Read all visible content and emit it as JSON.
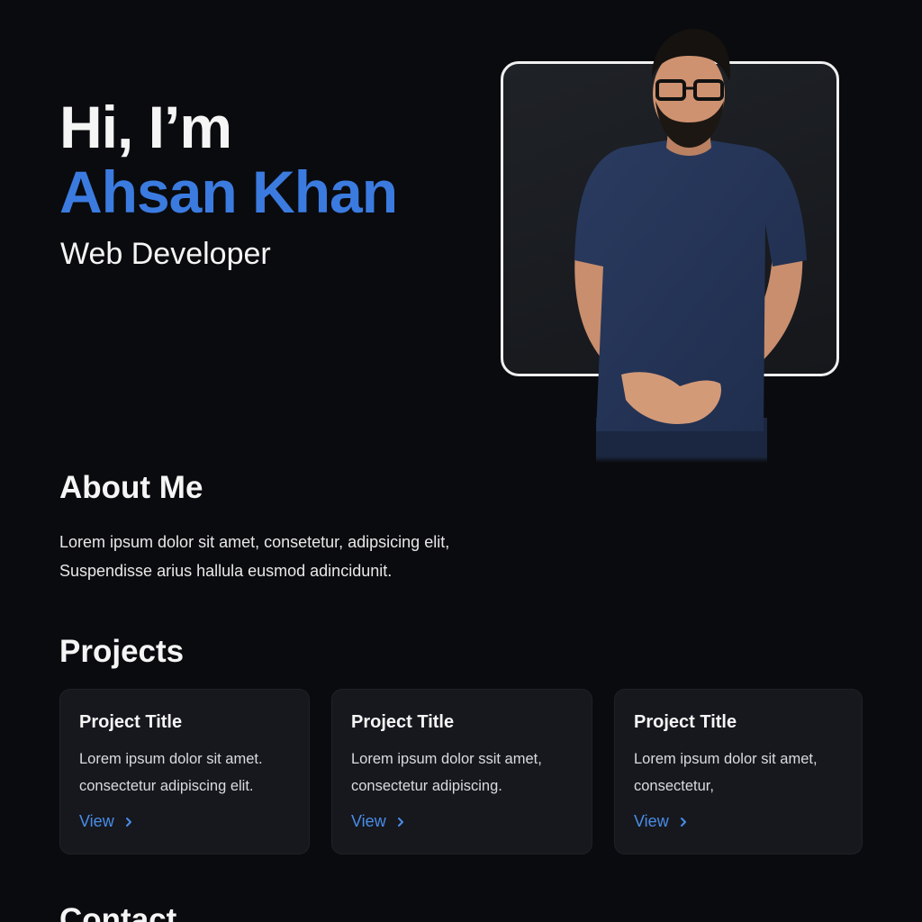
{
  "hero": {
    "greeting": "Hi, I’m",
    "name": "Ahsan Khan",
    "role": "Web Developer"
  },
  "about": {
    "title": "About Me",
    "lines": [
      "Lorem ipsum dolor sit amet, consetetur, adipsicing elit,",
      "Suspendisse arius hallula eusmod adincidunit."
    ]
  },
  "projects": {
    "title": "Projects",
    "items": [
      {
        "title": "Project Title",
        "desc": [
          "Lorem ipsum dolor sit amet.",
          "consectetur adipiscing elit."
        ],
        "link": "View"
      },
      {
        "title": "Project Title",
        "desc": [
          "Lorem ipsum dolor ssit amet,",
          "consectetur adipiscing."
        ],
        "link": "View"
      },
      {
        "title": "Project Title",
        "desc": [
          "Lorem ipsum dolor sit amet,",
          "consectetur,"
        ],
        "link": "View"
      }
    ]
  },
  "contact": {
    "title": "Contact"
  },
  "colors": {
    "background": "#0a0b0e",
    "accent": "#3b7be0",
    "card": "#16181d",
    "link": "#4a8ce8"
  },
  "icons": {
    "view_link": "chevron-right-icon"
  }
}
